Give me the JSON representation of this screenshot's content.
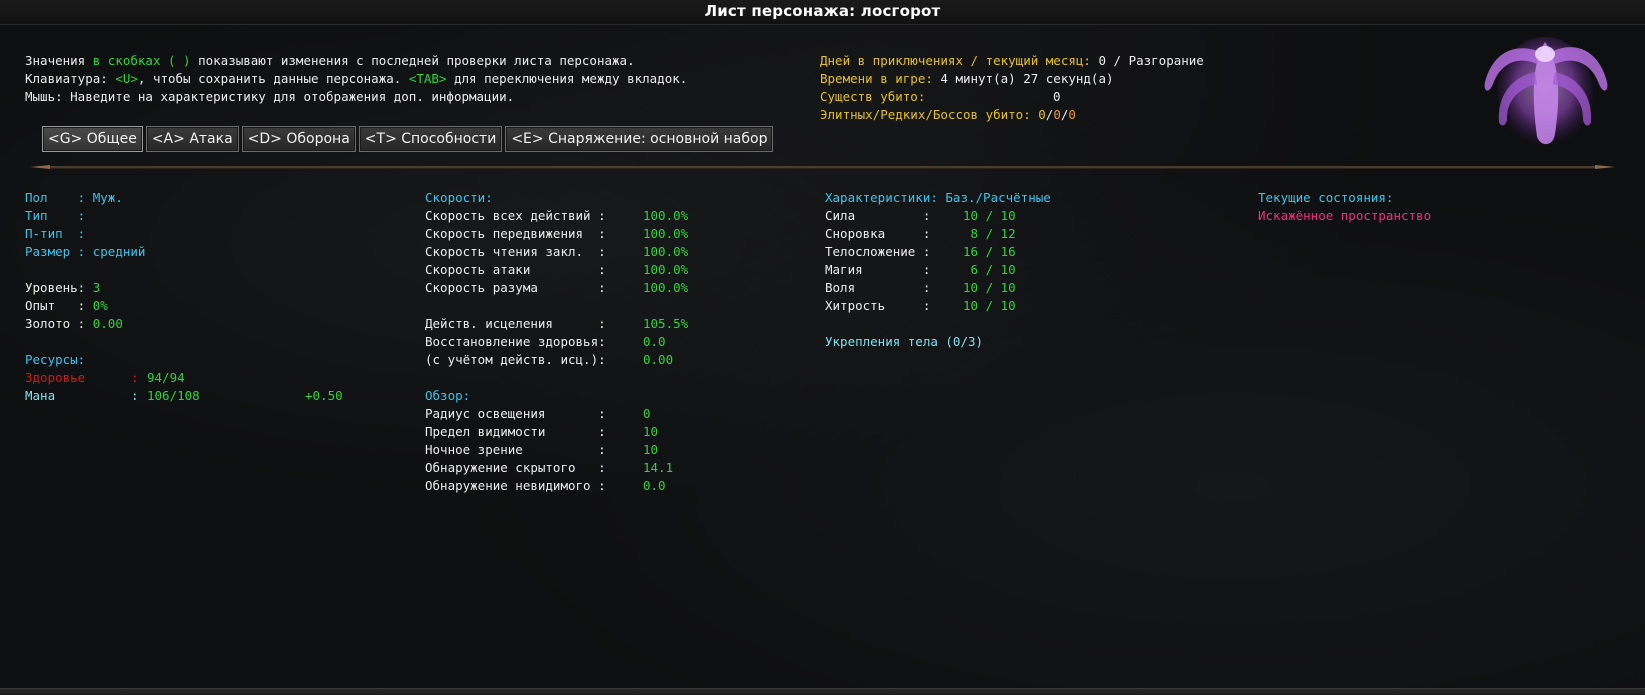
{
  "window": {
    "title": "Лист персонажа: лосгорот"
  },
  "help": {
    "line1_pre": "Значения ",
    "line1_hl": "в скобках ( )",
    "line1_post": " показывают изменения с последней проверки листа персонажа.",
    "line2_pre": "Клавиатура: ",
    "line2_key1": "<U>",
    "line2_mid": ", чтобы сохранить данные персонажа. ",
    "line2_key2": "<TAB>",
    "line2_post": " для переключения между вкладок.",
    "line3": "Мышь: Наведите на характеристику для отображения доп. информации."
  },
  "adventure": {
    "days_label": "Дней в приключениях / текущий месяц:",
    "days_value": "0 / Разгорание",
    "time_label": "Времени в игре:",
    "time_value": "4 минут(а) 27 секунд(а)",
    "killed_label": "Существ убито:",
    "killed_value": "0",
    "elite_label": "Элитных/Редких/Боссов убито:",
    "elite_v1": "0",
    "elite_sep1": "/",
    "elite_v2": "0",
    "elite_sep2": "/",
    "elite_v3": "0"
  },
  "tabs": [
    {
      "label": "<G> Общее",
      "active": true
    },
    {
      "label": "<A> Атака",
      "active": false
    },
    {
      "label": "<D> Оборона",
      "active": false
    },
    {
      "label": "<T> Способности",
      "active": false
    },
    {
      "label": "<E> Снаряжение: основной набор",
      "active": false
    }
  ],
  "general": {
    "sex_label": "Пол    :",
    "sex_value": "Муж.",
    "type_label": "Тип    :",
    "subtype_label": "П-тип  :",
    "size_label": "Размер :",
    "size_value": "средний",
    "level_label": "Уровень:",
    "level_value": "3",
    "exp_label": "Опыт   :",
    "exp_value": "0%",
    "gold_label": "Золото :",
    "gold_value": "0.00",
    "resources_header": "Ресурсы:",
    "health_label": "Здоровье",
    "health_colon": ":",
    "health_value": "94/94",
    "mana_label": "Мана",
    "mana_colon": ":",
    "mana_value": "106/108",
    "mana_regen": "+0.50"
  },
  "speeds": {
    "header": "Скорости:",
    "rows": [
      {
        "label": "Скорость всех действий :",
        "value": "100.0%"
      },
      {
        "label": "Скорость передвижения  :",
        "value": "100.0%"
      },
      {
        "label": "Скорость чтения закл.  :",
        "value": "100.0%"
      },
      {
        "label": "Скорость атаки         :",
        "value": "100.0%"
      },
      {
        "label": "Скорость разума        :",
        "value": "100.0%"
      }
    ],
    "heal_rows": [
      {
        "label": "Действ. исцеления      :",
        "value": "105.5%"
      },
      {
        "label": "Восстановление здоровья:",
        "value": "0.0"
      },
      {
        "label": "(с учётом действ. исц.):",
        "value": "0.00"
      }
    ]
  },
  "vision": {
    "header": "Обзор:",
    "rows": [
      {
        "label": "Радиус освещения       :",
        "value": "0"
      },
      {
        "label": "Предел видимости       :",
        "value": "10"
      },
      {
        "label": "Ночное зрение          :",
        "value": "10"
      },
      {
        "label": "Обнаружение скрытого   :",
        "value": "14.1"
      },
      {
        "label": "Обнаружение невидимого :",
        "value": "0.0"
      }
    ]
  },
  "stats": {
    "header": "Характеристики: Баз./Расчётные",
    "rows": [
      {
        "label": "Сила         :",
        "value": "10 / 10"
      },
      {
        "label": "Сноровка     :",
        "value": " 8 / 12"
      },
      {
        "label": "Телосложение :",
        "value": "16 / 16"
      },
      {
        "label": "Магия        :",
        "value": " 6 / 10"
      },
      {
        "label": "Воля         :",
        "value": "10 / 10"
      },
      {
        "label": "Хитрость     :",
        "value": "10 / 10"
      }
    ],
    "body_label": "Укрепления тела (0/3)"
  },
  "effects": {
    "header": "Текущие состояния:",
    "items": [
      "Искажённое пространство"
    ]
  },
  "colors": {
    "green": "#27d93a",
    "cyan": "#36c6ee",
    "yellow": "#e5c21b",
    "orange": "#e79a2c",
    "red": "#d11b1b",
    "pink": "#ef2f7c"
  },
  "portrait": {
    "icon": "horror-creature-icon"
  }
}
